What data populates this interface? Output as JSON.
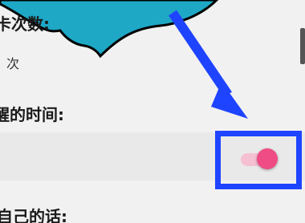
{
  "rows": [
    {
      "label": "卡次数:"
    },
    {
      "value": "次"
    },
    {
      "label": "醒的时间:"
    },
    {
      "label": "自己的话:"
    }
  ],
  "toggle": {
    "state": "on"
  },
  "colors": {
    "background": "#f1f1f1",
    "teal": "#1ea8c6",
    "highlight": "#1f44ff",
    "toggle_thumb": "#ef4b84",
    "toggle_track": "#f6c0d3"
  }
}
